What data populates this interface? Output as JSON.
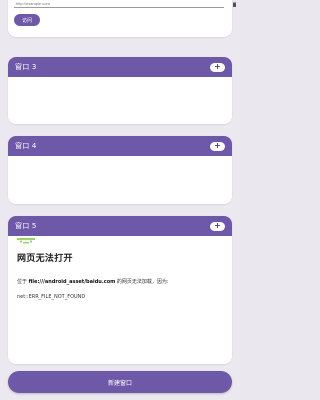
{
  "top_card": {
    "url_placeholder": "http://example.com",
    "visit_label": "访问"
  },
  "windows": [
    {
      "title": "窗口 3",
      "add_label": "+"
    },
    {
      "title": "窗口 4",
      "add_label": "+"
    },
    {
      "title": "窗口 5",
      "add_label": "+"
    }
  ],
  "error_page": {
    "title": "网页无法打开",
    "desc_prefix": "位于 ",
    "desc_url": "file:///android_asset/baidu.com",
    "desc_suffix": " 的网页无法加载，因为:",
    "error_code": "net::ERR_FILE_NOT_FOUND"
  },
  "bottom": {
    "new_window_label": "新建窗口"
  },
  "colors": {
    "accent": "#6e58a8",
    "background": "#ebe8ef",
    "sad_face": "#9bd36a"
  },
  "icons": {
    "status": [
      "wifi-icon",
      "signal-icon",
      "battery-icon"
    ],
    "error": "sad-page-icon"
  }
}
